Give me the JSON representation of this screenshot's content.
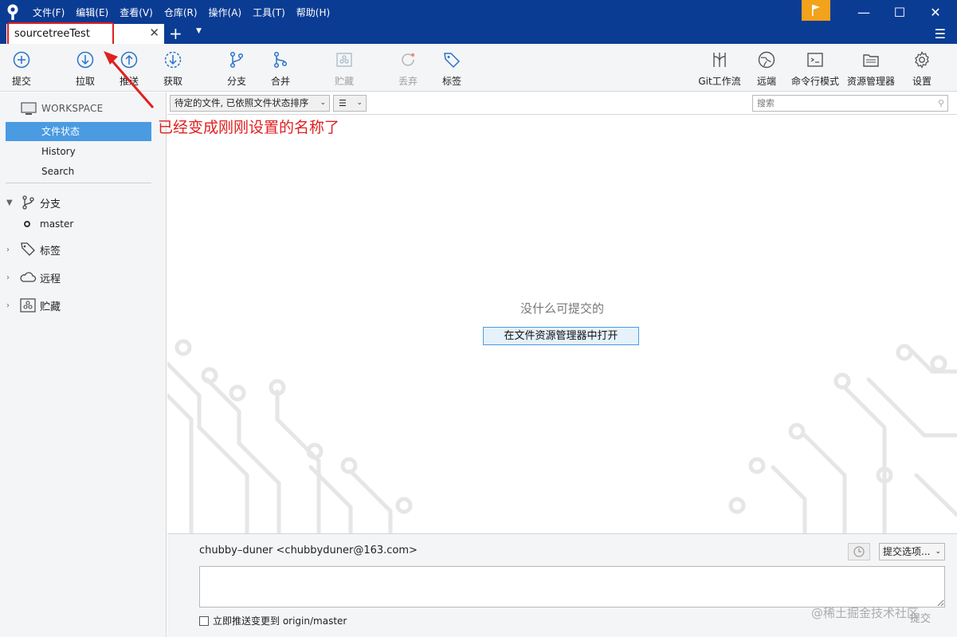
{
  "menu": [
    "文件(F)",
    "编辑(E)",
    "查看(V)",
    "仓库(R)",
    "操作(A)",
    "工具(T)",
    "帮助(H)"
  ],
  "window_controls": {
    "minimize": "—",
    "maximize": "☐",
    "close": "✕"
  },
  "tab": {
    "label": "sourcetreeTest",
    "close": "✕",
    "new": "+",
    "dropdown": "▼"
  },
  "toolbar": {
    "commit": "提交",
    "pull": "拉取",
    "push": "推送",
    "fetch": "获取",
    "branch": "分支",
    "merge": "合并",
    "stash": "贮藏",
    "discard": "丢弃",
    "tag": "标签",
    "git_flow": "Git工作流",
    "remote": "远端",
    "terminal": "命令行模式",
    "explorer": "资源管理器",
    "settings": "设置"
  },
  "annotation": "已经变成刚刚设置的名称了",
  "sidebar": {
    "workspace": "WORKSPACE",
    "items": [
      "文件状态",
      "History",
      "Search"
    ],
    "branches_title": "分支",
    "current_branch": "master",
    "tags_title": "标签",
    "remotes_title": "远程",
    "stashes_title": "贮藏"
  },
  "filter": {
    "sort": "待定的文件, 已依照文件状态排序",
    "view": "☰",
    "search_placeholder": "搜索"
  },
  "main": {
    "empty_message": "没什么可提交的",
    "open_explorer": "在文件资源管理器中打开"
  },
  "commit": {
    "author": "chubby–duner <chubbyduner@163.com>",
    "options": "提交选项...",
    "push_label": "立即推送变更到 origin/master",
    "button": "提交"
  },
  "watermark": "@稀土掘金技术社区",
  "colors": {
    "titlebar": "#0b3c93",
    "selection": "#4a9be2",
    "annotation": "#e02020",
    "flag": "#f3a21b"
  }
}
